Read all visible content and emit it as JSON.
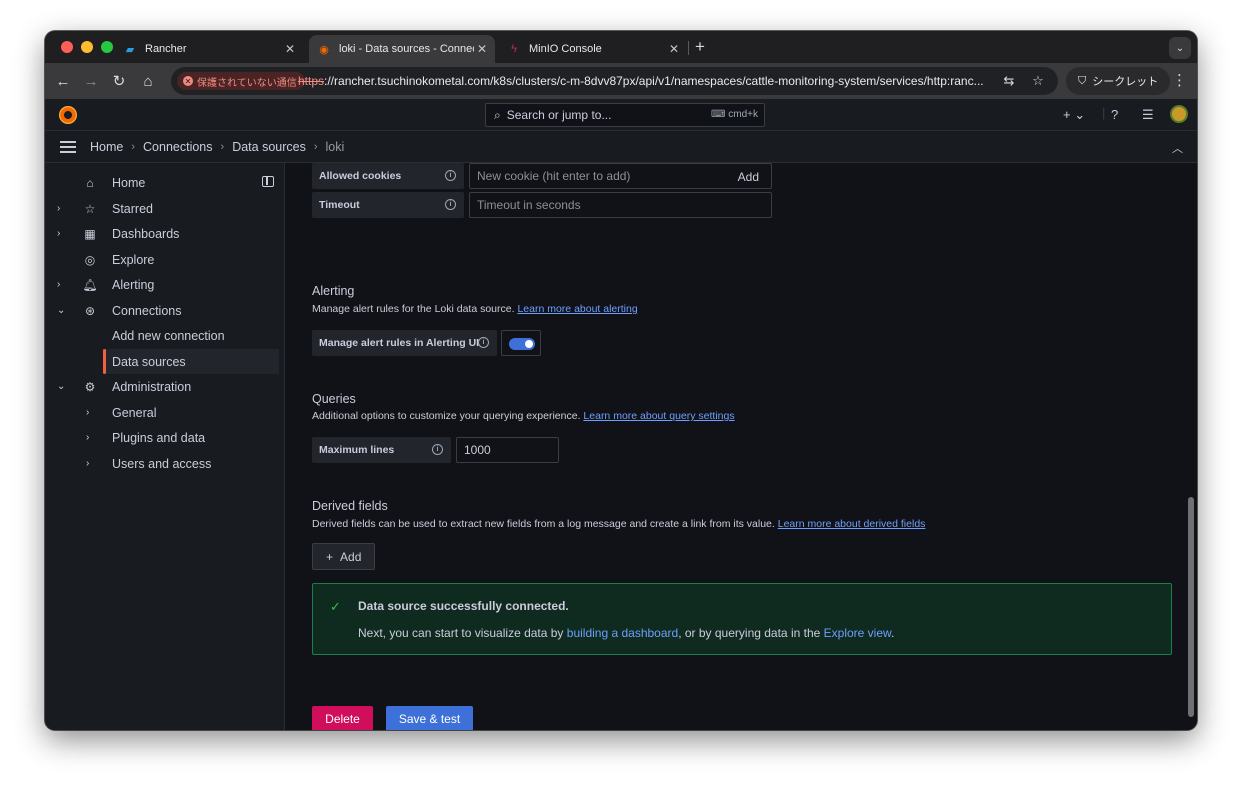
{
  "browser": {
    "tabs": [
      {
        "title": "Rancher",
        "favicon": "rancher-icon",
        "active": false
      },
      {
        "title": "loki - Data sources - Connect",
        "favicon": "grafana-icon",
        "active": true
      },
      {
        "title": "MinIO Console",
        "favicon": "minio-icon",
        "active": false
      }
    ],
    "security_chip": "保護されていない通信",
    "url_scheme": "https",
    "url_rest": "://rancher.tsuchinokometal.com/k8s/clusters/c-m-8dvv87px/api/v1/namespaces/cattle-monitoring-system/services/http:ranc...",
    "incognito_label": "シークレット"
  },
  "grafana": {
    "search_placeholder": "Search or jump to...",
    "search_shortcut": "cmd+k",
    "breadcrumb": [
      "Home",
      "Connections",
      "Data sources",
      "loki"
    ]
  },
  "sidebar": {
    "items": [
      {
        "label": "Home",
        "icon": "home-icon"
      },
      {
        "label": "Starred",
        "icon": "star-icon"
      },
      {
        "label": "Dashboards",
        "icon": "dashboards-icon"
      },
      {
        "label": "Explore",
        "icon": "compass-icon"
      },
      {
        "label": "Alerting",
        "icon": "bell-icon"
      },
      {
        "label": "Connections",
        "icon": "connections-icon"
      },
      {
        "label": "Add new connection"
      },
      {
        "label": "Data sources",
        "selected": true
      },
      {
        "label": "Administration",
        "icon": "gear-icon"
      },
      {
        "label": "General"
      },
      {
        "label": "Plugins and data"
      },
      {
        "label": "Users and access"
      }
    ]
  },
  "form": {
    "allowed_cookies_label": "Allowed cookies",
    "allowed_cookies_placeholder": "New cookie (hit enter to add)",
    "allowed_cookies_add": "Add",
    "timeout_label": "Timeout",
    "timeout_placeholder": "Timeout in seconds",
    "alerting_title": "Alerting",
    "alerting_desc": "Manage alert rules for the Loki data source.",
    "alerting_link": "Learn more about alerting",
    "alerting_toggle_label": "Manage alert rules in Alerting UI",
    "alerting_toggle_on": true,
    "queries_title": "Queries",
    "queries_desc": "Additional options to customize your querying experience.",
    "queries_link": "Learn more about query settings",
    "max_lines_label": "Maximum lines",
    "max_lines_value": "1000",
    "derived_title": "Derived fields",
    "derived_desc": "Derived fields can be used to extract new fields from a log message and create a link from its value.",
    "derived_link": "Learn more about derived fields",
    "derived_add": "Add"
  },
  "alert": {
    "title": "Data source successfully connected.",
    "text_before": "Next, you can start to visualize data by ",
    "link1": "building a dashboard",
    "text_middle": ", or by querying data in the ",
    "link2": "Explore view",
    "text_after": "."
  },
  "actions": {
    "delete": "Delete",
    "save_test": "Save & test"
  },
  "colors": {
    "delete": "#d10e5c",
    "save": "#3d71d9",
    "success_border": "#1a7f4b",
    "link": "#6e9fff",
    "selected_bar": "#f55f3e"
  }
}
